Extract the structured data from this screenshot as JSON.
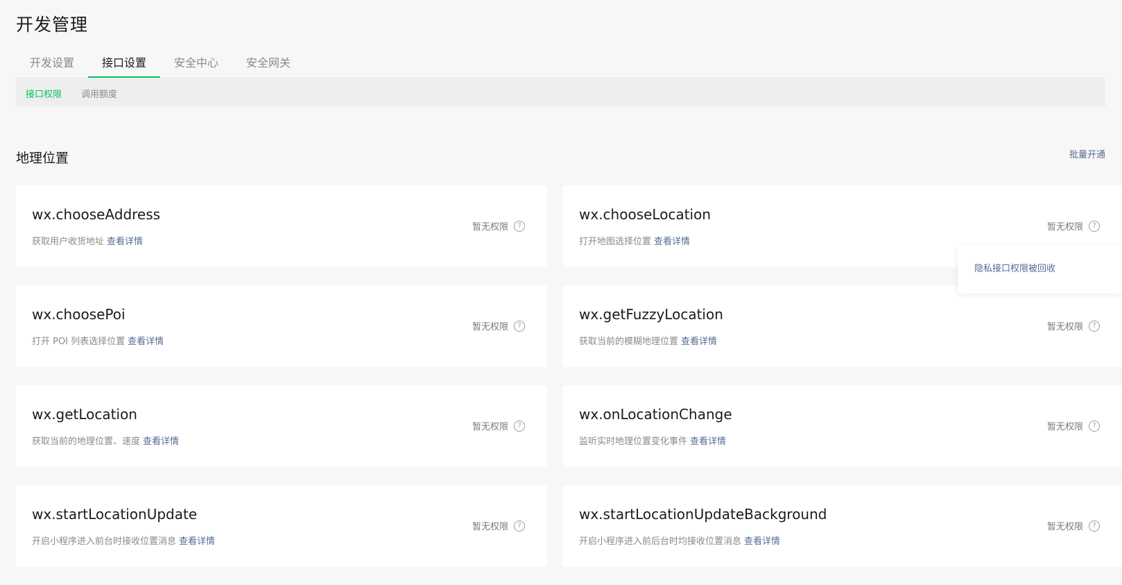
{
  "page": {
    "title": "开发管理"
  },
  "tabs": [
    {
      "label": "开发设置"
    },
    {
      "label": "接口设置"
    },
    {
      "label": "安全中心"
    },
    {
      "label": "安全网关"
    }
  ],
  "subtabs": [
    {
      "label": "接口权限"
    },
    {
      "label": "调用额度"
    }
  ],
  "section": {
    "title": "地理位置",
    "batch_label": "批量开通"
  },
  "detail_label": "查看详情",
  "status_label": "暂无权限",
  "help_icon": "question-circle-icon",
  "cards": [
    {
      "name": "wx.chooseAddress",
      "desc": "获取用户收货地址"
    },
    {
      "name": "wx.chooseLocation",
      "desc": "打开地图选择位置"
    },
    {
      "name": "wx.choosePoi",
      "desc": "打开 POI 列表选择位置"
    },
    {
      "name": "wx.getFuzzyLocation",
      "desc": "获取当前的模糊地理位置"
    },
    {
      "name": "wx.getLocation",
      "desc": "获取当前的地理位置、速度"
    },
    {
      "name": "wx.onLocationChange",
      "desc": "监听实时地理位置变化事件"
    },
    {
      "name": "wx.startLocationUpdate",
      "desc": "开启小程序进入前台时接收位置消息"
    },
    {
      "name": "wx.startLocationUpdateBackground",
      "desc": "开启小程序进入前后台时均接收位置消息"
    }
  ],
  "tooltip": {
    "text": "隐私接口权限被回收"
  },
  "colors": {
    "accent": "#07c160",
    "link": "#576b95",
    "background": "#f7f7f7"
  }
}
